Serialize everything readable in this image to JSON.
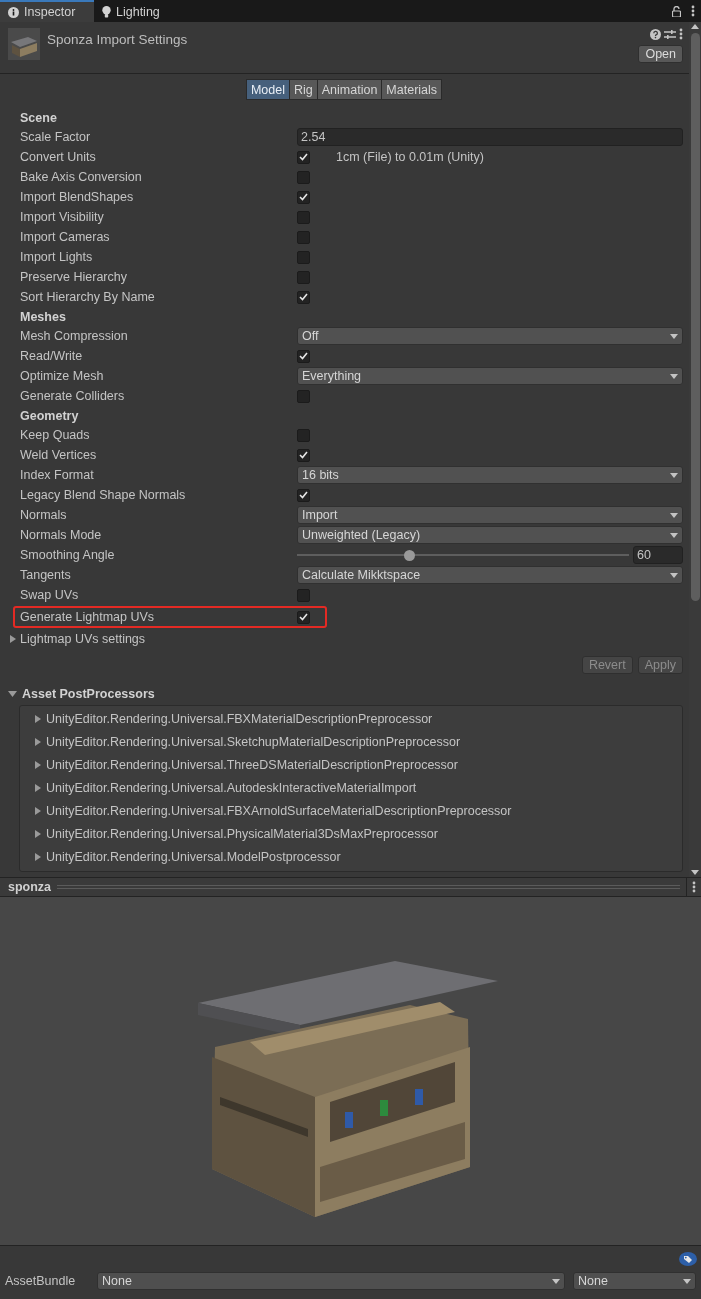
{
  "editor_tabs": [
    {
      "label": "Inspector",
      "kind": "info",
      "selected": true
    },
    {
      "label": "Lighting",
      "kind": "bulb",
      "selected": false
    }
  ],
  "asset": {
    "title": "Sponza Import Settings",
    "open_button": "Open"
  },
  "import_tabs": [
    {
      "label": "Model",
      "selected": true
    },
    {
      "label": "Rig",
      "selected": false
    },
    {
      "label": "Animation",
      "selected": false
    },
    {
      "label": "Materials",
      "selected": false
    }
  ],
  "properties": [
    {
      "kind": "header",
      "label": "Scene"
    },
    {
      "kind": "text",
      "label": "Scale Factor",
      "value": "2.54"
    },
    {
      "kind": "checkbox",
      "label": "Convert Units",
      "checked": true,
      "note": "1cm (File) to 0.01m (Unity)"
    },
    {
      "kind": "checkbox",
      "label": "Bake Axis Conversion",
      "checked": false
    },
    {
      "kind": "checkbox",
      "label": "Import BlendShapes",
      "checked": true
    },
    {
      "kind": "checkbox",
      "label": "Import Visibility",
      "checked": false
    },
    {
      "kind": "checkbox",
      "label": "Import Cameras",
      "checked": false
    },
    {
      "kind": "checkbox",
      "label": "Import Lights",
      "checked": false
    },
    {
      "kind": "checkbox",
      "label": "Preserve Hierarchy",
      "checked": false
    },
    {
      "kind": "checkbox",
      "label": "Sort Hierarchy By Name",
      "checked": true
    },
    {
      "kind": "header",
      "label": "Meshes"
    },
    {
      "kind": "dropdown",
      "label": "Mesh Compression",
      "value": "Off"
    },
    {
      "kind": "checkbox",
      "label": "Read/Write",
      "checked": true
    },
    {
      "kind": "dropdown",
      "label": "Optimize Mesh",
      "value": "Everything"
    },
    {
      "kind": "checkbox",
      "label": "Generate Colliders",
      "checked": false
    },
    {
      "kind": "header",
      "label": "Geometry"
    },
    {
      "kind": "checkbox",
      "label": "Keep Quads",
      "checked": false
    },
    {
      "kind": "checkbox",
      "label": "Weld Vertices",
      "checked": true
    },
    {
      "kind": "dropdown",
      "label": "Index Format",
      "value": "16 bits"
    },
    {
      "kind": "checkbox",
      "label": "Legacy Blend Shape Normals",
      "checked": true
    },
    {
      "kind": "dropdown",
      "label": "Normals",
      "value": "Import"
    },
    {
      "kind": "dropdown",
      "label": "Normals Mode",
      "value": "Unweighted (Legacy)"
    },
    {
      "kind": "slider",
      "label": "Smoothing Angle",
      "level": 0.336,
      "value": "60"
    },
    {
      "kind": "dropdown",
      "label": "Tangents",
      "value": "Calculate Mikktspace"
    },
    {
      "kind": "checkbox",
      "label": "Swap UVs",
      "checked": false
    },
    {
      "kind": "checkbox",
      "label": "Generate Lightmap UVs",
      "checked": true,
      "highlighted": true
    },
    {
      "kind": "foldout",
      "label": "Lightmap UVs settings",
      "expanded": false
    }
  ],
  "actions": [
    {
      "label": "Revert",
      "disabled": true
    },
    {
      "label": "Apply",
      "disabled": true
    }
  ],
  "post_processors": {
    "title": "Asset PostProcessors",
    "expanded": true,
    "items": [
      {
        "label": "UnityEditor.Rendering.Universal.FBXMaterialDescriptionPreprocessor",
        "expanded": false
      },
      {
        "label": "UnityEditor.Rendering.Universal.SketchupMaterialDescriptionPreprocessor",
        "expanded": false
      },
      {
        "label": "UnityEditor.Rendering.Universal.ThreeDSMaterialDescriptionPreprocessor",
        "expanded": false
      },
      {
        "label": "UnityEditor.Rendering.Universal.AutodeskInteractiveMaterialImport",
        "expanded": false
      },
      {
        "label": "UnityEditor.Rendering.Universal.FBXArnoldSurfaceMaterialDescriptionPreprocessor",
        "expanded": false
      },
      {
        "label": "UnityEditor.Rendering.Universal.PhysicalMaterial3DsMaxPreprocessor",
        "expanded": false
      },
      {
        "label": "UnityEditor.Rendering.Universal.ModelPostprocessor",
        "expanded": false
      }
    ]
  },
  "preview": {
    "title": "sponza"
  },
  "asset_bundle": {
    "label": "AssetBundle",
    "name": "None",
    "variant": "None"
  }
}
